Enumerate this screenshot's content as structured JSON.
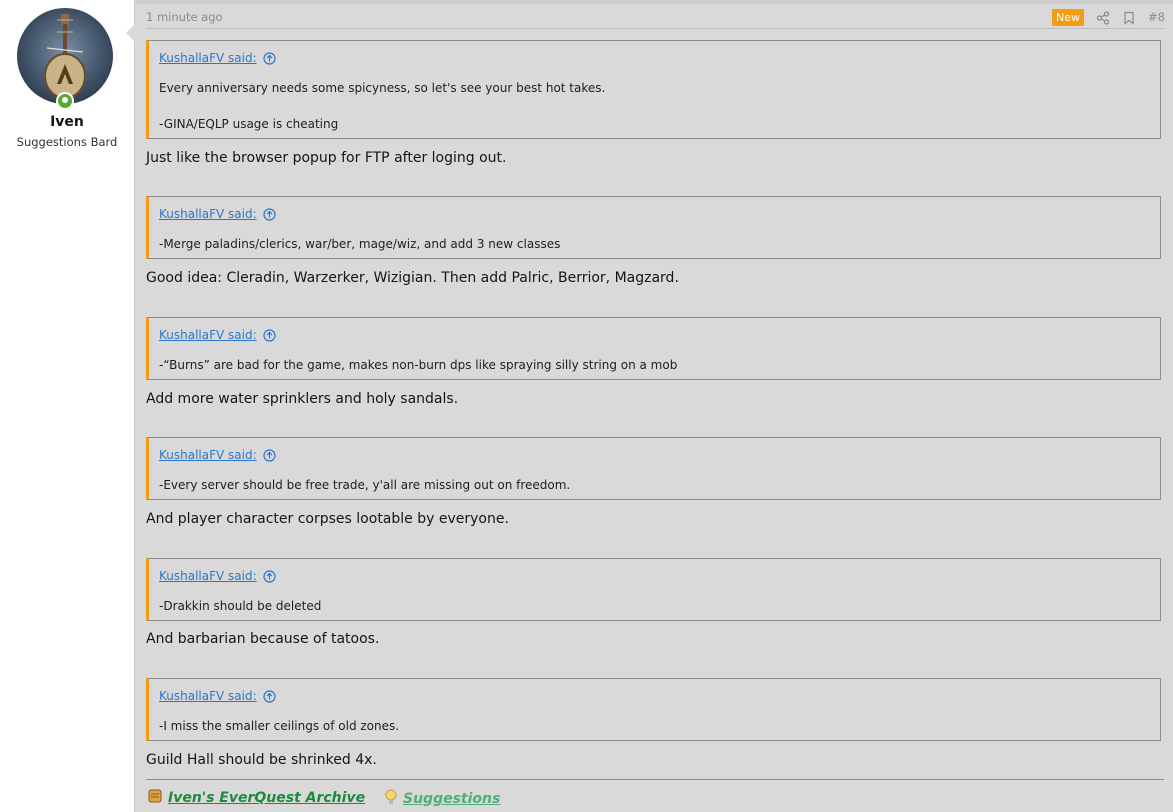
{
  "user": {
    "name": "Iven",
    "title": "Suggestions Bard"
  },
  "post": {
    "time": "1 minute ago",
    "badge": "New",
    "number": "#8"
  },
  "blocks": [
    {
      "author": "KushallaFV said:",
      "lines": [
        "Every anniversary needs some spicyness, so let's see your best hot takes.",
        "-GINA/EQLP usage is cheating"
      ],
      "reply": "Just like the browser popup for FTP after loging out."
    },
    {
      "author": "KushallaFV said:",
      "lines": [
        "-Merge paladins/clerics, war/ber, mage/wiz, and add 3 new classes"
      ],
      "reply": "Good idea: Cleradin, Warzerker, Wizigian. Then add Palric, Berrior, Magzard."
    },
    {
      "author": "KushallaFV said:",
      "lines": [
        "-“Burns” are bad for the game, makes non-burn dps like spraying silly string on a mob"
      ],
      "reply": "Add more water sprinklers and holy sandals."
    },
    {
      "author": "KushallaFV said:",
      "lines": [
        "-Every server should be free trade, y'all are missing out on freedom."
      ],
      "reply": "And player character corpses lootable by everyone."
    },
    {
      "author": "KushallaFV said:",
      "lines": [
        "-Drakkin should be deleted"
      ],
      "reply": "And barbarian because of tatoos."
    },
    {
      "author": "KushallaFV said:",
      "lines": [
        "-I miss the smaller ceilings of old zones."
      ],
      "reply": "Guild Hall should be shrinked 4x."
    }
  ],
  "signature": {
    "link1": {
      "icon": "scroll-icon",
      "label": "Iven's EverQuest Archive",
      "color": "#1e8a3e"
    },
    "link2": {
      "icon": "lightbulb-icon",
      "label": "Suggestions",
      "color": "#4fae7a"
    }
  },
  "colors": {
    "accent": "#f39c12",
    "link": "#2a77c9",
    "background": "#d9d9d9"
  }
}
